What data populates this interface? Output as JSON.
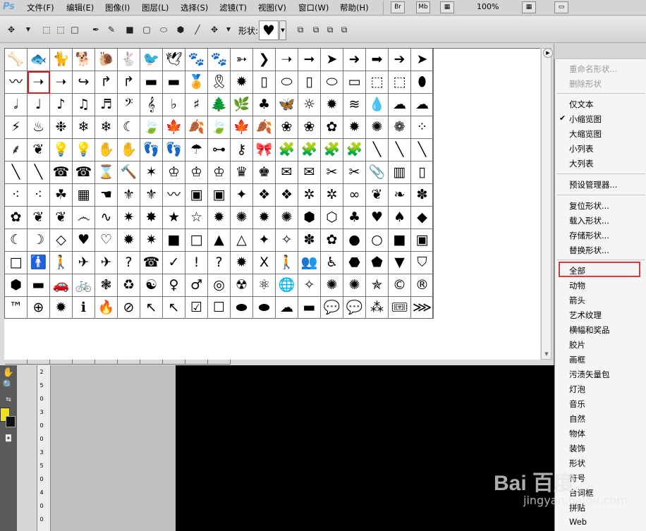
{
  "app": {
    "logo": "Ps"
  },
  "menubar": {
    "items": [
      "文件(F)",
      "编辑(E)",
      "图像(I)",
      "图层(L)",
      "选择(S)",
      "滤镜(T)",
      "视图(V)",
      "窗口(W)",
      "帮助(H)"
    ],
    "br_label": "Br",
    "mb_label": "Mb",
    "zoom": "100%"
  },
  "options": {
    "shape_label": "形状:",
    "current_shape": "♥"
  },
  "shapes": [
    "🦴",
    "🐟",
    "🐈",
    "🐕",
    "🐌",
    "🐇",
    "🐦",
    "🕊",
    "🐾",
    "🐾",
    "➳",
    "❯",
    "➝",
    "➞",
    "➤",
    "➜",
    "➡",
    "➔",
    "➤",
    "〰",
    "➝",
    "➝",
    "↪",
    "↱",
    "↱",
    "▬",
    "▬",
    "🏅",
    "🎗",
    "✹",
    "▯",
    "⬭",
    "▯",
    "⬭",
    "▭",
    "⬚",
    "⬚",
    "⬮",
    "𝅗𝅥",
    "♩",
    "♪",
    "♫",
    "♬",
    "𝄢",
    "𝄞",
    "♭",
    "♯",
    "🌲",
    "🌿",
    "♣",
    "🦋",
    "☼",
    "✹",
    "≋",
    "💧",
    "☁",
    "☁",
    "⚡",
    "♨",
    "❉",
    "❄",
    "❄",
    "☾",
    "🍃",
    "🍁",
    "🍂",
    "🍃",
    "🍁",
    "🍂",
    "❀",
    "❀",
    "✿",
    "✹",
    "✺",
    "❁",
    "⁘",
    "⸙",
    "❦",
    "💡",
    "💡",
    "✋",
    "✋",
    "👣",
    "👣",
    "☂",
    "⊶",
    "⚷",
    "🎀",
    "🧩",
    "🧩",
    "🧩",
    "🧩",
    "╲",
    "╲",
    "╲",
    "╲",
    "╲",
    "☎",
    "☎",
    "⌛",
    "🔨",
    "✶",
    "♔",
    "♔",
    "♔",
    "♛",
    "♚",
    "✉",
    "✉",
    "✂",
    "✂",
    "📎",
    "▥",
    "▯",
    "⁖",
    "⁖",
    "☘",
    "▦",
    "☚",
    "⚜",
    "⚜",
    "〰",
    "▣",
    "▣",
    "✦",
    "❖",
    "❖",
    "✲",
    "✲",
    "∞",
    "❦",
    "❧",
    "✽",
    "✿",
    "❦",
    "❦",
    "෴",
    "∿",
    "✷",
    "✸",
    "★",
    "☆",
    "✹",
    "✺",
    "✹",
    "✺",
    "⬢",
    "⬡",
    "♣",
    "♥",
    "♠",
    "◆",
    "☾",
    "☽",
    "◇",
    "♥",
    "♡",
    "✹",
    "✷",
    "■",
    "□",
    "▲",
    "△",
    "✦",
    "✧",
    "✽",
    "✿",
    "●",
    "○",
    "■",
    "▣",
    "□",
    "🚹",
    "🚶",
    "✈",
    "✈",
    "?",
    "☎",
    "✓",
    "!",
    "?",
    "✹",
    "X",
    "🚶",
    "👥",
    "♿",
    "⬣",
    "⬟",
    "▼",
    "⛉",
    "⬢",
    "▬",
    "🚗",
    "🚲",
    "❃",
    "♻",
    "☯",
    "♀",
    "♂",
    "◎",
    "☢",
    "⚛",
    "🌐",
    "✧",
    "✺",
    "✺",
    "✯",
    "©",
    "®",
    "™",
    "⊕",
    "✹",
    "ℹ",
    "🔥",
    "⊘",
    "↖",
    "↖",
    "☑",
    "☐",
    "⬬",
    "⬬",
    "☁",
    "▬",
    "💬",
    "💬",
    "⁂",
    "🎟",
    "⋙",
    "▨",
    "⬖",
    "▩",
    "⛶",
    "▦",
    "⊕",
    "⊖",
    "⊘",
    "◀",
    "▶",
    "⊙",
    "⊛",
    "⇩",
    "✉",
    "☑",
    "⌂",
    "?",
    "⊘",
    "⊚",
    "♪",
    "♫",
    "🔍",
    "🔍",
    "🛒",
    "🔊",
    "▬",
    "◷",
    "🔧",
    "🌐"
  ],
  "selected_shape_index": 20,
  "menu": {
    "items": [
      {
        "label": "重命名形状...",
        "disabled": true
      },
      {
        "label": "删除形状",
        "disabled": true
      },
      {
        "label": "仅文本"
      },
      {
        "label": "小缩览图",
        "checked": true
      },
      {
        "label": "大缩览图"
      },
      {
        "label": "小列表"
      },
      {
        "label": "大列表"
      },
      {
        "label": "预设管理器..."
      },
      {
        "label": "复位形状..."
      },
      {
        "label": "载入形状..."
      },
      {
        "label": "存储形状..."
      },
      {
        "label": "替换形状..."
      },
      {
        "label": "全部",
        "highlighted": true
      },
      {
        "label": "动物"
      },
      {
        "label": "箭头"
      },
      {
        "label": "艺术纹理"
      },
      {
        "label": "横幅和奖品"
      },
      {
        "label": "胶片"
      },
      {
        "label": "画框"
      },
      {
        "label": "污渍矢量包"
      },
      {
        "label": "灯泡"
      },
      {
        "label": "音乐"
      },
      {
        "label": "自然"
      },
      {
        "label": "物体"
      },
      {
        "label": "装饰"
      },
      {
        "label": "形状"
      },
      {
        "label": "符号"
      },
      {
        "label": "台词框"
      },
      {
        "label": "拼贴"
      },
      {
        "label": "Web"
      }
    ]
  },
  "ruler_labels": [
    "2",
    "5",
    "0",
    "3",
    "0",
    "0",
    "3",
    "5",
    "0",
    "4",
    "0",
    "0"
  ],
  "watermark": {
    "main": "Bai 百度",
    "sub": "jingyan.baidu.com"
  }
}
